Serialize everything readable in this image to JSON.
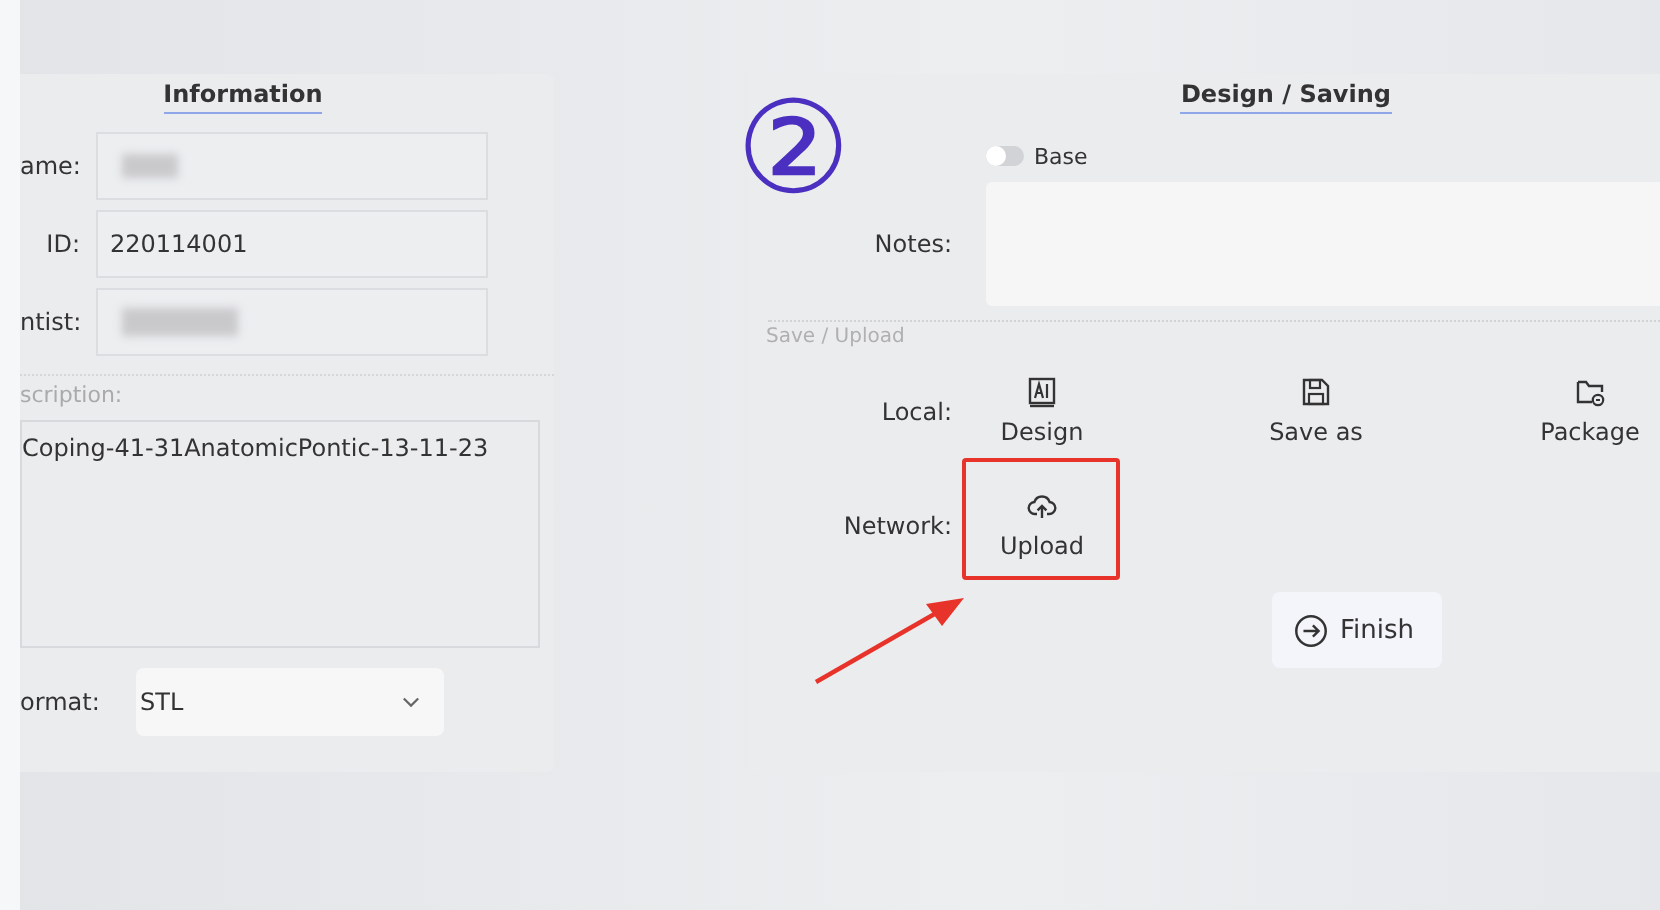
{
  "step_marker": "②",
  "information": {
    "title": "Information",
    "fields": [
      {
        "label": "ame:",
        "redacted": true
      },
      {
        "label": "ID:",
        "value": "220114001",
        "redacted": false
      },
      {
        "label": "ntist:",
        "redacted": true
      }
    ],
    "description": {
      "label": "scription:",
      "value": "Coping-41-31AnatomicPontic-13-11-23"
    },
    "format": {
      "label": "ormat:",
      "value": "STL"
    }
  },
  "design_saving": {
    "title": "Design / Saving",
    "base_toggle": {
      "label": "Base",
      "on": false
    },
    "notes": {
      "label": "Notes:"
    },
    "section_label": "Save / Upload",
    "rows": [
      {
        "label": "Local:",
        "actions": [
          {
            "label": "Design",
            "kind": "design",
            "highlighted": false
          },
          {
            "label": "Save as",
            "kind": "save",
            "highlighted": false
          },
          {
            "label": "Package",
            "kind": "package",
            "highlighted": false
          }
        ]
      },
      {
        "label": "Network:",
        "actions": [
          {
            "label": "Upload",
            "kind": "upload",
            "highlighted": true
          }
        ]
      }
    ],
    "finish": "Finish"
  }
}
